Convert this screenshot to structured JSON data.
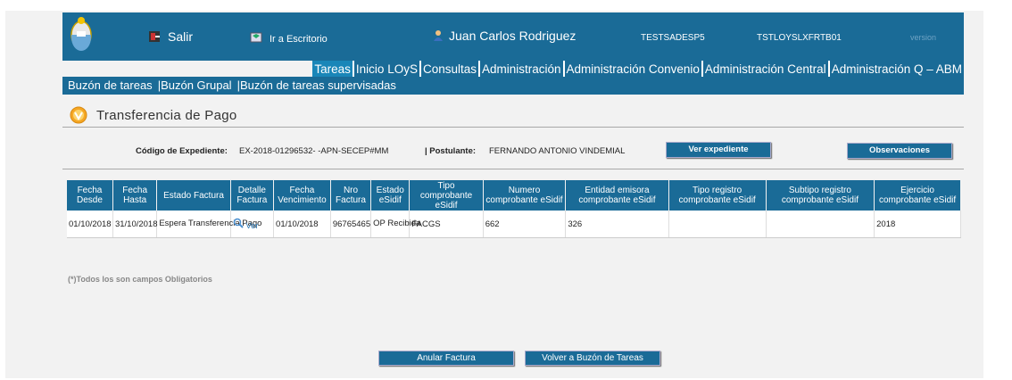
{
  "header": {
    "salir_label": "Salir",
    "escritorio_label": "Ir a Escritorio",
    "user_name": "Juan Carlos Rodriguez",
    "env1": "TESTSADESP5",
    "env2": "TSTLOYSLXFRTB01",
    "version_label": "version"
  },
  "menu": {
    "items": [
      "Tareas",
      "Inicio LOyS",
      "Consultas",
      "Administración",
      "Administración Convenio",
      "Administración Central",
      "Administración Q – ABM"
    ]
  },
  "subnav": {
    "items": [
      "Buzón de tareas",
      "Buzón Grupal",
      "Buzón de tareas supervisadas"
    ],
    "separator": "|"
  },
  "page": {
    "title": "Transferencia de Pago"
  },
  "info": {
    "expediente_label": "Código de Expediente:",
    "expediente_value": "EX-2018-01296532- -APN-SECEP#MM",
    "postulante_label": "| Postulante:",
    "postulante_value": "FERNANDO ANTONIO VINDEMIAL",
    "ver_expediente_button": "Ver expediente",
    "observaciones_button": "Observaciones"
  },
  "table": {
    "headers": [
      "Fecha Desde",
      "Fecha Hasta",
      "Estado Factura",
      "Detalle Factura",
      "Fecha Vencimiento",
      "Nro Factura",
      "Estado eSidif",
      "Tipo comprobante eSidif",
      "Numero comprobante eSidif",
      "Entidad emisora comprobante eSidif",
      "Tipo registro comprobante eSidif",
      "Subtipo registro comprobante eSidif",
      "Ejercicio comprobante eSidif"
    ],
    "rows": [
      {
        "fecha_desde": "01/10/2018",
        "fecha_hasta": "31/10/2018",
        "estado_factura": "Espera Transferencia Pago",
        "detalle_link": "Ver",
        "fecha_vencimiento": "01/10/2018",
        "nro_factura": "96765465",
        "estado_esidif": "OP Recibida",
        "tipo_comprobante": "FACGS",
        "numero_comprobante": "662",
        "entidad_emisora": "326",
        "tipo_registro": "",
        "subtipo_registro": "",
        "ejercicio": "2018"
      }
    ]
  },
  "footer": {
    "note": "(*)Todos los son campos Obligatorios",
    "anular_button": "Anular Factura",
    "volver_button": "Volver a Buzón de Tareas"
  },
  "colors": {
    "primary": "#1a6b97",
    "active_menu": "#1a86b8",
    "link": "#2a78b5",
    "background": "#f2f2f2"
  },
  "icons": [
    "coat-of-arms-logo",
    "exit-icon",
    "desktop-icon",
    "user-icon",
    "page-title-icon",
    "magnifier-icon"
  ]
}
